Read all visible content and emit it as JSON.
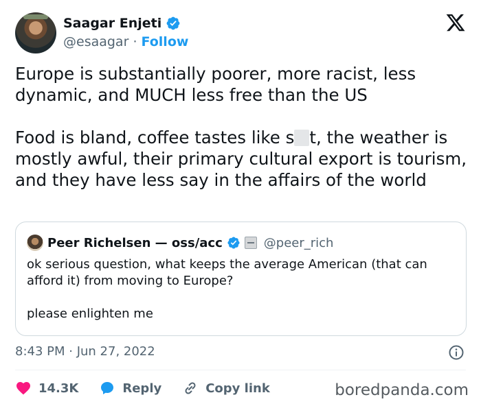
{
  "author": {
    "name": "Saagar Enjeti",
    "handle": "@esaagar",
    "separator": "·",
    "follow_label": "Follow"
  },
  "tweet": {
    "line1": "Europe is substantially poorer, more racist, less dynamic, and MUCH less free than the US",
    "line2_before": "Food is bland, coffee tastes like s",
    "line2_after": "t, the weather is mostly awful, their primary cultural export is tourism, and they have less say in the affairs of the world"
  },
  "quote": {
    "name": "Peer Richelsen — oss/acc",
    "handle": "@peer_rich",
    "text": "ok serious question, what keeps the average American (that can afford it) from moving to Europe?\n\nplease enlighten me"
  },
  "meta": {
    "timestamp": "8:43 PM · Jun 27, 2022"
  },
  "actions": {
    "likes": "14.3K",
    "reply_label": "Reply",
    "copy_label": "Copy link"
  },
  "watermark": "boredpanda.com",
  "colors": {
    "accent": "#1d9bf0",
    "like": "#f91880",
    "text": "#0f1419",
    "muted": "#536471"
  },
  "icons": [
    "verified-icon",
    "x-logo-icon",
    "info-icon",
    "heart-icon",
    "reply-icon",
    "link-icon"
  ]
}
